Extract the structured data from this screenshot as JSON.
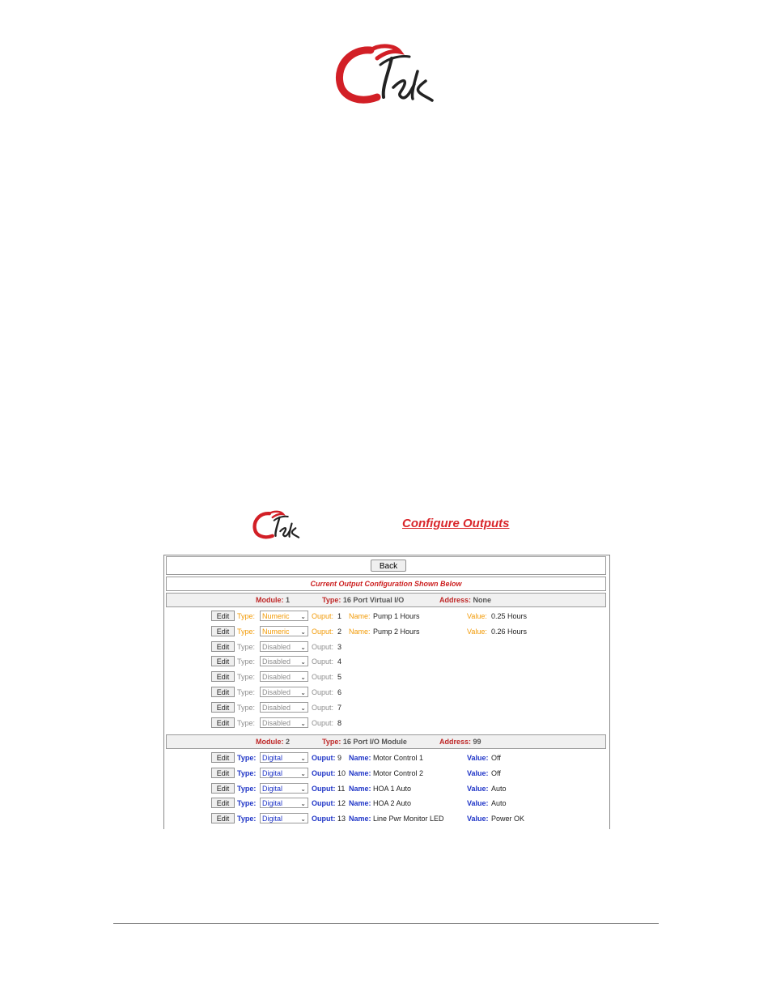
{
  "page": {
    "title": "Configure Outputs",
    "logo_text": "Ctek"
  },
  "toolbar": {
    "back_label": "Back"
  },
  "banner": "Current Output Configuration Shown Below",
  "labels": {
    "type": "Type:",
    "ouput": "Ouput:",
    "name": "Name:",
    "value": "Value:",
    "module": "Module:",
    "address": "Address:",
    "edit": "Edit"
  },
  "modules": [
    {
      "module": "1",
      "type": "16 Port Virtual I/O",
      "address": "None",
      "outputs": [
        {
          "type": "Numeric",
          "ouput": "1",
          "name": "Pump 1 Hours",
          "value": "0.25 Hours"
        },
        {
          "type": "Numeric",
          "ouput": "2",
          "name": "Pump 2 Hours",
          "value": "0.26 Hours"
        },
        {
          "type": "Disabled",
          "ouput": "3"
        },
        {
          "type": "Disabled",
          "ouput": "4"
        },
        {
          "type": "Disabled",
          "ouput": "5"
        },
        {
          "type": "Disabled",
          "ouput": "6"
        },
        {
          "type": "Disabled",
          "ouput": "7"
        },
        {
          "type": "Disabled",
          "ouput": "8"
        }
      ]
    },
    {
      "module": "2",
      "type": "16 Port I/O Module",
      "address": "99",
      "outputs": [
        {
          "type": "Digital",
          "ouput": "9",
          "name": "Motor Control 1",
          "value": "Off"
        },
        {
          "type": "Digital",
          "ouput": "10",
          "name": "Motor Control 2",
          "value": "Off"
        },
        {
          "type": "Digital",
          "ouput": "11",
          "name": "HOA 1 Auto",
          "value": "Auto"
        },
        {
          "type": "Digital",
          "ouput": "12",
          "name": "HOA 2 Auto",
          "value": "Auto"
        },
        {
          "type": "Digital",
          "ouput": "13",
          "name": "Line Pwr Monitor LED",
          "value": "Power OK"
        }
      ]
    }
  ]
}
